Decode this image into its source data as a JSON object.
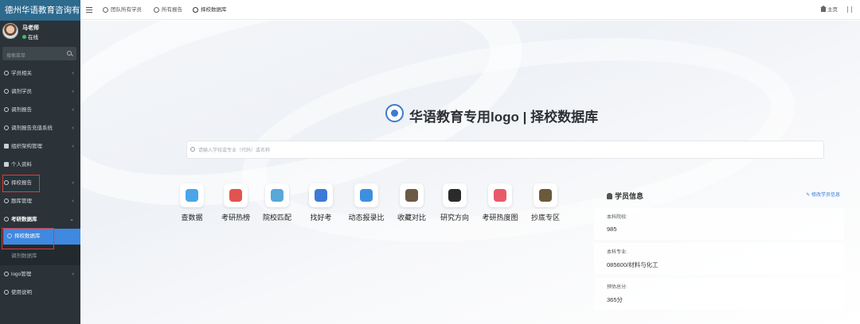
{
  "sidebar": {
    "brand": "德州华语教育咨询有",
    "user": {
      "name": "马老师",
      "status": "在线"
    },
    "search_placeholder": "搜索菜单",
    "menu": [
      {
        "label": "学员相关"
      },
      {
        "label": "调剂学员"
      },
      {
        "label": "调剂报告"
      },
      {
        "label": "调剂报告充值系统"
      },
      {
        "label": "组织架构管理"
      },
      {
        "label": "个人资料"
      },
      {
        "label": "择校报告"
      },
      {
        "label": "题库管理"
      },
      {
        "label": "考研数据库"
      },
      {
        "label": "择校数据库"
      },
      {
        "label": "调剂数据库"
      },
      {
        "label": "logo管理"
      },
      {
        "label": "使用说明"
      }
    ]
  },
  "topbar": {
    "tabs": [
      {
        "label": "团队所有学员"
      },
      {
        "label": "所有报告"
      },
      {
        "label": "择校数据库"
      }
    ],
    "home": "主页"
  },
  "main": {
    "heading": "华语教育专用logo | 择校数据库",
    "search_placeholder": "请输入学校或专业（代码）或名称",
    "quick_links": [
      {
        "label": "查数据",
        "color": "#4aa6e8"
      },
      {
        "label": "考研热榜",
        "color": "#e0544f"
      },
      {
        "label": "院校匹配",
        "color": "#58a8d8"
      },
      {
        "label": "找好考",
        "color": "#3b7ad6"
      },
      {
        "label": "动态报录比",
        "color": "#3f8fe0"
      },
      {
        "label": "收藏对比",
        "color": "#6b5a45"
      },
      {
        "label": "研究方向",
        "color": "#2b2b2b"
      },
      {
        "label": "考研热度图",
        "color": "#e85a6a"
      },
      {
        "label": "抄底专区",
        "color": "#6b5a3a"
      }
    ],
    "student": {
      "title": "学员信息",
      "edit_label": "修改学员信息",
      "fields": [
        {
          "label": "本科院校:",
          "value": "985"
        },
        {
          "label": "本科专业:",
          "value": "085600/材料与化工"
        },
        {
          "label": "预估总分:",
          "value": "365分"
        }
      ]
    }
  },
  "colors": {
    "sidebar_bg": "#2b3338",
    "brand_bg": "#2c6a8e",
    "active_bg": "#3f89e0",
    "highlight_border": "#e03a3a",
    "link": "#3b7ad6"
  }
}
